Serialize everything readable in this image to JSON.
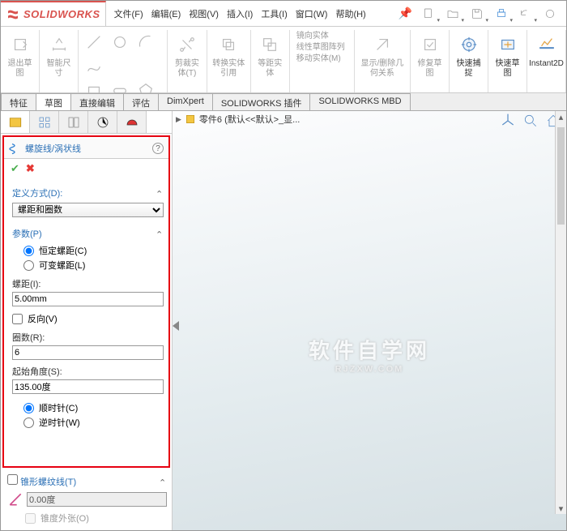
{
  "app": {
    "title": "SOLIDWORKS"
  },
  "menu": {
    "file": "文件(F)",
    "edit": "编辑(E)",
    "view": "视图(V)",
    "insert": "插入(I)",
    "tools": "工具(I)",
    "window": "窗口(W)",
    "help": "帮助(H)"
  },
  "ribbon": {
    "g1a": "退出草图",
    "g1b": "智能尺寸",
    "g_trim": "剪裁实体(T)",
    "g_convert": "转换实体引用",
    "g_offset": "等距实体",
    "g_mirror": "镜向实体",
    "g_pattern": "线性草图阵列",
    "g_move": "移动实体(M)",
    "g_disp": "显示/删除几何关系",
    "g_repair": "修复草图",
    "g_snap": "快速捕捉",
    "g_rapid": "快速草图",
    "g_instant": "Instant2D"
  },
  "tabs": {
    "t1": "特征",
    "t2": "草图",
    "t3": "直接编辑",
    "t4": "评估",
    "t5": "DimXpert",
    "t6": "SOLIDWORKS 插件",
    "t7": "SOLIDWORKS MBD"
  },
  "crumb": "零件6 (默认<<默认>_显...",
  "pm": {
    "title": "螺旋线/涡状线",
    "def_section": "定义方式(D):",
    "def_value": "螺距和圈数",
    "params_section": "参数(P)",
    "r_const": "恒定螺距(C)",
    "r_var": "可变螺距(L)",
    "pitch_label": "螺距(I):",
    "pitch_value": "5.00mm",
    "reverse": "反向(V)",
    "rev_label": "圈数(R):",
    "rev_value": "6",
    "angle_label": "起始角度(S):",
    "angle_value": "135.00度",
    "cw": "顺时针(C)",
    "ccw": "逆时针(W)",
    "taper_section": "锥形螺纹线(T)",
    "taper_value": "0.00度",
    "taper_out": "锥度外张(O)"
  },
  "watermark": {
    "l1": "软件自学网",
    "l2": "RJZXW.COM"
  }
}
